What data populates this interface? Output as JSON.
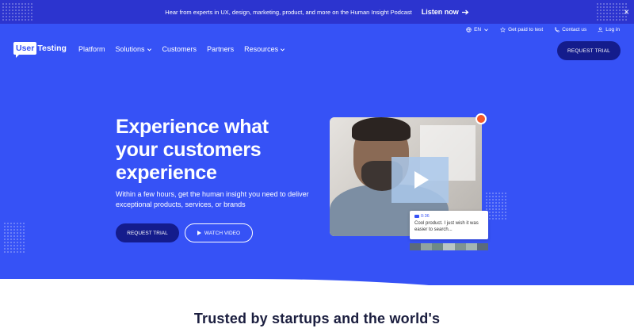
{
  "promo": {
    "text": "Hear from experts in UX, design, marketing, product, and more on the Human Insight Podcast",
    "link": "Listen now",
    "close": "×"
  },
  "util_nav": {
    "language": "EN",
    "get_paid": "Get paid to test",
    "contact": "Contact us",
    "login": "Log in"
  },
  "logo": {
    "boxed": "User",
    "rest": "Testing"
  },
  "main_nav": {
    "items": [
      {
        "label": "Platform",
        "dropdown": false
      },
      {
        "label": "Solutions",
        "dropdown": true
      },
      {
        "label": "Customers",
        "dropdown": false
      },
      {
        "label": "Partners",
        "dropdown": false
      },
      {
        "label": "Resources",
        "dropdown": true
      }
    ]
  },
  "header_cta": "REQUEST TRIAL",
  "hero": {
    "headline_line1": "Experience what",
    "headline_line2": "your customers",
    "headline_line3": "experience",
    "subtext": "Within a few hours, get the human insight you need to deliver exceptional products, services, or brands",
    "cta_primary": "REQUEST TRIAL",
    "cta_secondary": "WATCH VIDEO"
  },
  "video_card": {
    "timestamp": "0:36",
    "comment": "Cool product. I just wish it was easier to search..."
  },
  "trusted_heading": "Trusted by startups and the world's",
  "colors": {
    "brand_blue": "#3652f6",
    "dark_navy": "#141c8c",
    "promo_bar": "#2c34cf",
    "record_dot": "#f25a2c"
  }
}
